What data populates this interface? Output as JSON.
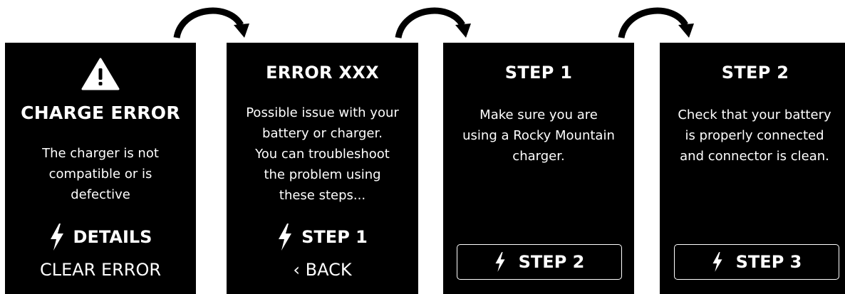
{
  "screens": [
    {
      "title": "CHARGE ERROR",
      "message_lines": [
        "The charger is not",
        "compatible or is",
        "defective"
      ],
      "primary_action": "DETAILS",
      "secondary_action": "CLEAR ERROR",
      "icon": "warning-triangle-icon"
    },
    {
      "title": "ERROR XXX",
      "message_lines": [
        "Possible issue with your",
        "battery or charger.",
        "You can troubleshoot",
        "the problem using",
        "these steps..."
      ],
      "primary_action": "STEP 1",
      "secondary_action": "‹ BACK"
    },
    {
      "title": "STEP 1",
      "message_lines": [
        "Make sure you are",
        "using a Rocky Mountain",
        "charger."
      ],
      "primary_action": "STEP 2"
    },
    {
      "title": "STEP 2",
      "message_lines": [
        "Check that your battery",
        "is properly connected",
        "and connector is clean."
      ],
      "primary_action": "STEP 3"
    }
  ],
  "icons": {
    "action_icon": "lightning-bolt-icon",
    "flow_arrow": "curved-arrow-icon"
  },
  "colors": {
    "screen_background": "#000000",
    "screen_text": "#ffffff",
    "page_background": "#ffffff",
    "arrow": "#000000"
  }
}
